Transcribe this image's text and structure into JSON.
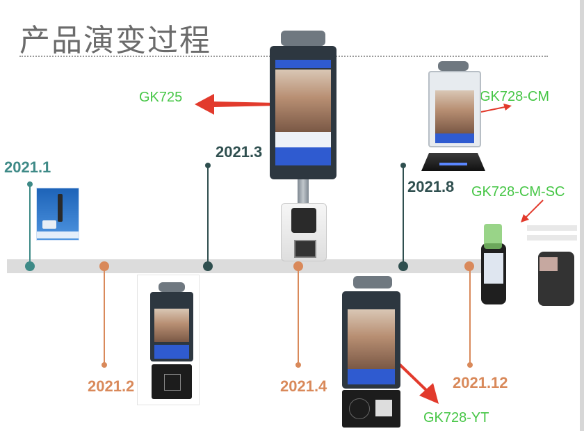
{
  "title": "产品演变过程",
  "dates": {
    "d2021_1": "2021.1",
    "d2021_2": "2021.2",
    "d2021_3": "2021.3",
    "d2021_4": "2021.4",
    "d2021_8": "2021.8",
    "d2021_12": "2021.12"
  },
  "products": {
    "gk725": "GK725",
    "gk728_cm": "GK728-CM",
    "gk728_cm_sc": "GK728-CM-SC",
    "gk728_yt": "GK728-YT"
  },
  "colors": {
    "teal": "#3e8a87",
    "dark_teal": "#2f4f4f",
    "orange": "#d9895a",
    "green_label": "#46c646",
    "arrow_red": "#e23a2c"
  }
}
